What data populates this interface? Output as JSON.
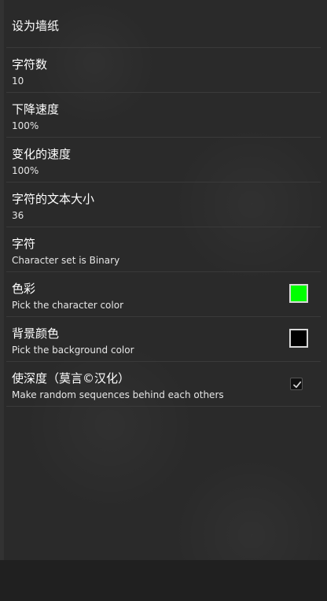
{
  "settings": {
    "rows": [
      {
        "title": "设为墙纸",
        "summary": ""
      },
      {
        "title": "字符数",
        "summary": "10"
      },
      {
        "title": "下降速度",
        "summary": "100%"
      },
      {
        "title": "变化的速度",
        "summary": "100%"
      },
      {
        "title": "字符的文本大小",
        "summary": "36"
      },
      {
        "title": "字符",
        "summary": "Character set is Binary"
      },
      {
        "title": "色彩",
        "summary": "Pick the character color",
        "swatch": "#00ff00"
      },
      {
        "title": "背景颜色",
        "summary": "Pick the background color",
        "swatch": "#000000"
      },
      {
        "title": "使深度（莫言©汉化）",
        "summary": "Make random sequences behind each others",
        "checked": true
      }
    ]
  },
  "colors": {
    "screen_bg": "#2a2a2a",
    "divider": "#3a3a3a",
    "character_color": "#00ff00",
    "background_color": "#000000"
  },
  "icons": {
    "check": "checkmark-icon"
  }
}
